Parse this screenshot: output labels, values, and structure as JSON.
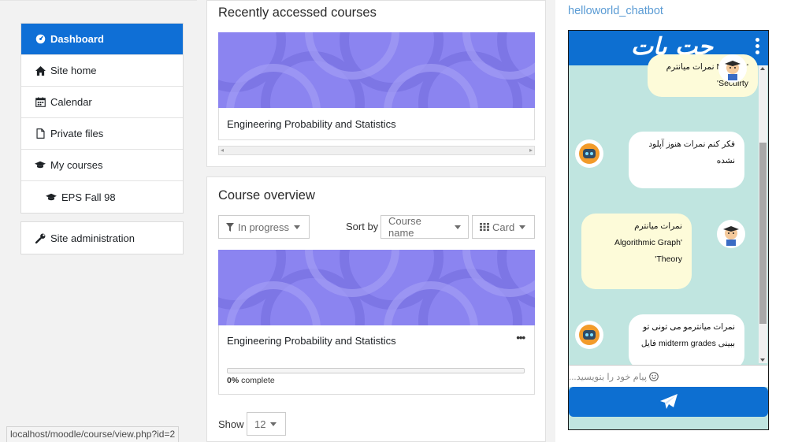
{
  "nav": {
    "items": [
      {
        "label": "Dashboard",
        "icon": "tachometer-icon",
        "active": true
      },
      {
        "label": "Site home",
        "icon": "home-icon"
      },
      {
        "label": "Calendar",
        "icon": "calendar-icon"
      },
      {
        "label": "Private files",
        "icon": "file-icon"
      },
      {
        "label": "My courses",
        "icon": "graduation-cap-icon"
      },
      {
        "label": "EPS Fall 98",
        "icon": "graduation-cap-icon"
      }
    ],
    "admin": {
      "label": "Site administration",
      "icon": "wrench-icon"
    }
  },
  "status_url": "localhost/moodle/course/view.php?id=2",
  "recent": {
    "title": "Recently accessed courses",
    "course_name": "Engineering Probability and Statistics"
  },
  "overview": {
    "title": "Course overview",
    "filter_label": "In progress",
    "sort_label": "Sort by",
    "sort_value": "Course name",
    "view_label": "Card",
    "course_name": "Engineering Probability and Statistics",
    "progress_percent": "0%",
    "progress_suffix": " complete",
    "progress_fraction": 0,
    "more_label": "•••",
    "show_label": "Show",
    "show_value": "12"
  },
  "chat": {
    "widget_title": "helloworld_chatbot",
    "header_title": "چت بات",
    "messages": [
      {
        "from": "user",
        "lines": [
          "'Network نمرات میانترم",
          "Secuirty'"
        ]
      },
      {
        "from": "bot",
        "lines": [
          "فکر کنم نمرات هنوز آپلود",
          "نشده"
        ]
      },
      {
        "from": "user",
        "lines": [
          "نمرات میانترم",
          "'Algorithmic Graph",
          "Theory'"
        ]
      },
      {
        "from": "bot",
        "lines": [
          "نمرات میانترمو می تونی تو",
          "ببینی midterm grades فایل"
        ]
      }
    ],
    "input_placeholder": "پیام خود را بنویسید...",
    "colors": {
      "header": "#0d6fd1",
      "background": "#c0e5e0",
      "user_bubble": "#fdfbd9",
      "bot_bubble": "#ffffff"
    }
  },
  "colors": {
    "accent": "#0f6fd6",
    "course_image": "#8b84f0"
  }
}
